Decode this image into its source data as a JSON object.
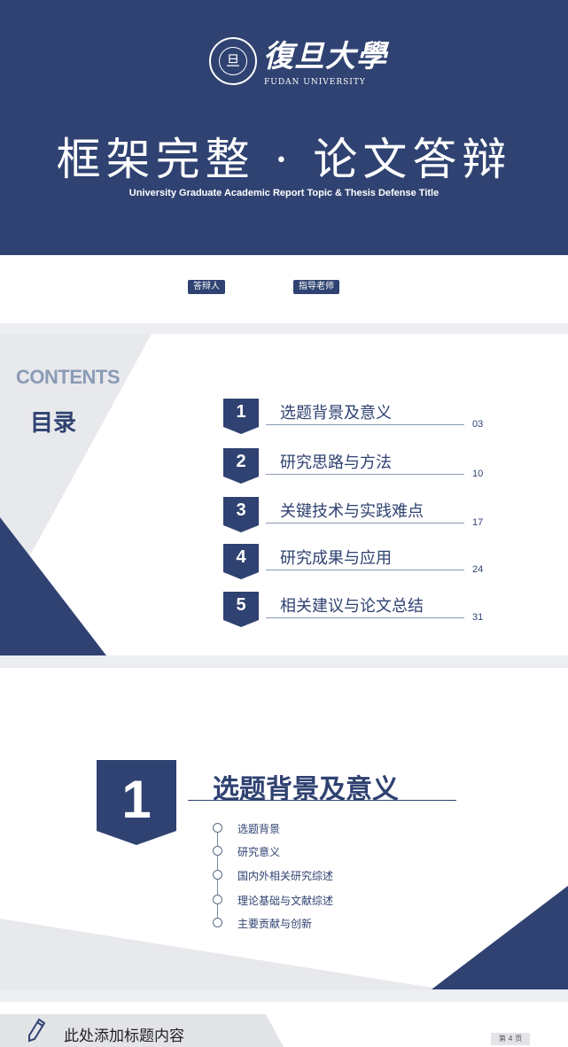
{
  "slide1": {
    "logo_inner": "旦",
    "university_calligraphy": "復旦大學",
    "university_en": "FUDAN UNIVERSITY",
    "title_cn": "框架完整 · 论文答辩",
    "title_en": "University Graduate Academic Report Topic & Thesis Defense Title",
    "tag_respondent": "答辩人",
    "tag_advisor": "指导老师"
  },
  "slide2": {
    "contents_en": "CONTENTS",
    "contents_cn": "目录",
    "items": [
      {
        "num": "1",
        "label": "选题背景及意义",
        "page": "03"
      },
      {
        "num": "2",
        "label": "研究思路与方法",
        "page": "10"
      },
      {
        "num": "3",
        "label": "关键技术与实践难点",
        "page": "17"
      },
      {
        "num": "4",
        "label": "研究成果与应用",
        "page": "24"
      },
      {
        "num": "5",
        "label": "相关建议与论文总结",
        "page": "31"
      }
    ]
  },
  "slide3": {
    "section_number": "1",
    "section_title": "选题背景及意义",
    "subitems": [
      "选题背景",
      "研究意义",
      "国内外相关研究综述",
      "理论基础与文献综述",
      "主要贡献与创新"
    ]
  },
  "slide4": {
    "title": "此处添加标题内容",
    "page_label": "第 4 页"
  },
  "colors": {
    "navy": "#2f4271",
    "slate": "#8a9bb5",
    "light_gray": "#e2e4e8"
  },
  "icons": [
    "pencil-icon",
    "university-seal-icon"
  ]
}
